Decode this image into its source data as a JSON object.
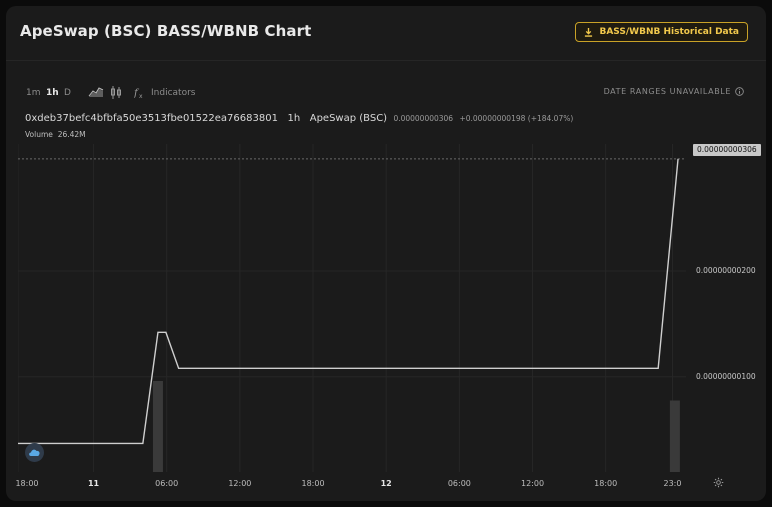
{
  "header": {
    "title": "ApeSwap (BSC) BASS/WBNB Chart",
    "historical_button": "BASS/WBNB Historical Data"
  },
  "toolbar": {
    "intervals": [
      "1m",
      "1h",
      "D"
    ],
    "active_interval": "1h",
    "indicators_label": "Indicators",
    "date_ranges_label": "DATE RANGES UNAVAILABLE"
  },
  "legend": {
    "pair_address": "0xdeb37befc4bfbfa50e3513fbe01522ea76683801",
    "interval": "1h",
    "exchange": "ApeSwap (BSC)",
    "price": "0.00000000306",
    "change": "+0.00000000198 (+184.07%)",
    "volume_label": "Volume",
    "volume_value": "26.42M"
  },
  "chart_data": {
    "type": "line",
    "price_series": {
      "t": [
        0,
        15.7,
        17.6,
        18.6,
        20.2,
        80.5,
        83.0
      ],
      "y": [
        3.7e-10,
        3.7e-10,
        1.42e-09,
        1.42e-09,
        1.08e-09,
        1.08e-09,
        3.06e-09
      ]
    },
    "volume_bars": [
      {
        "t": 17.6,
        "volume_fraction": 0.7
      },
      {
        "t": 82.6,
        "volume_fraction": 0.55
      }
    ],
    "y_ticks": [
      "0.00000000100",
      "0.00000000200"
    ],
    "y_tick_values": [
      1e-09,
      2e-09
    ],
    "ylim": [
      1e-10,
      3.2e-09
    ],
    "x_ticks": [
      {
        "label": "18:00",
        "t": 0
      },
      {
        "label": "11",
        "t": 9.5
      },
      {
        "label": "06:00",
        "t": 18.7
      },
      {
        "label": "12:00",
        "t": 27.9
      },
      {
        "label": "18:00",
        "t": 37.1
      },
      {
        "label": "12",
        "t": 46.3
      },
      {
        "label": "06:00",
        "t": 55.5
      },
      {
        "label": "12:00",
        "t": 64.7
      },
      {
        "label": "18:00",
        "t": 73.9
      },
      {
        "label": "23:0",
        "t": 82.3
      }
    ],
    "x_bold_labels": [
      "11",
      "12"
    ],
    "last_price_label": "0.00000000306",
    "grid": true,
    "colors": {
      "line": "#cfcfcf",
      "volume": "#3a3a3a",
      "grid": "#262626"
    }
  }
}
